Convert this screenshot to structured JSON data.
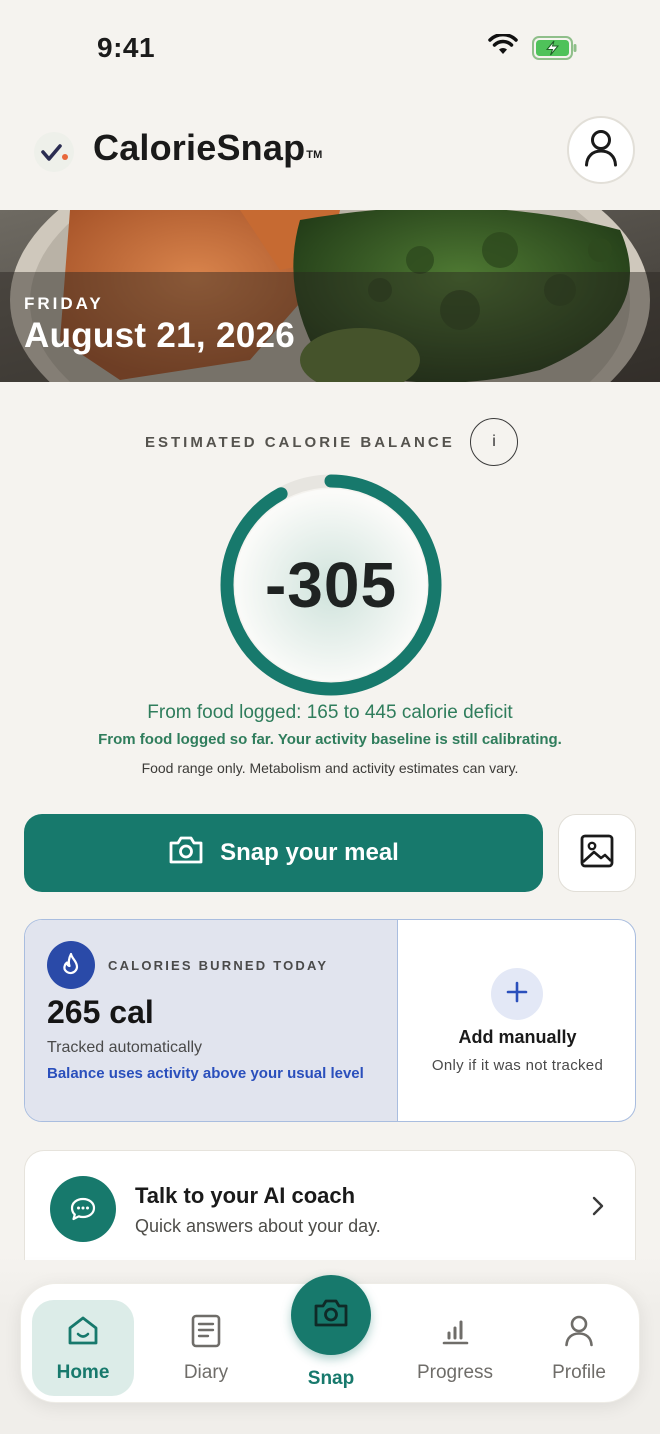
{
  "status_bar": {
    "time": "9:41"
  },
  "header": {
    "app_name": "CalorieSnap",
    "trademark": "TM"
  },
  "hero": {
    "day": "FRIDAY",
    "date": "August 21, 2026"
  },
  "balance": {
    "label": "ESTIMATED CALORIE BALANCE",
    "info_label": "i",
    "value": "-305",
    "ring_progress": 0.92,
    "range_text": "From food logged: 165 to 445 calorie deficit",
    "sub_text": "From food logged so far. Your activity baseline is still calibrating.",
    "disclaimer": "Food range only. Metabolism and activity estimates can vary."
  },
  "actions": {
    "snap_label": "Snap your meal"
  },
  "burned": {
    "label": "CALORIES BURNED TODAY",
    "value": "265 cal",
    "tracked": "Tracked automatically",
    "note": "Balance uses activity above your usual level",
    "add_title": "Add manually",
    "add_sub": "Only if it was not tracked"
  },
  "coach": {
    "title": "Talk to your AI coach",
    "subtitle": "Quick answers about your day."
  },
  "nav": {
    "home": "Home",
    "diary": "Diary",
    "snap": "Snap",
    "progress": "Progress",
    "profile": "Profile"
  },
  "colors": {
    "accent": "#17796c",
    "positive_text": "#2f7d5c",
    "burn_blue": "#2a4aa8",
    "background": "#f5f3ef"
  }
}
